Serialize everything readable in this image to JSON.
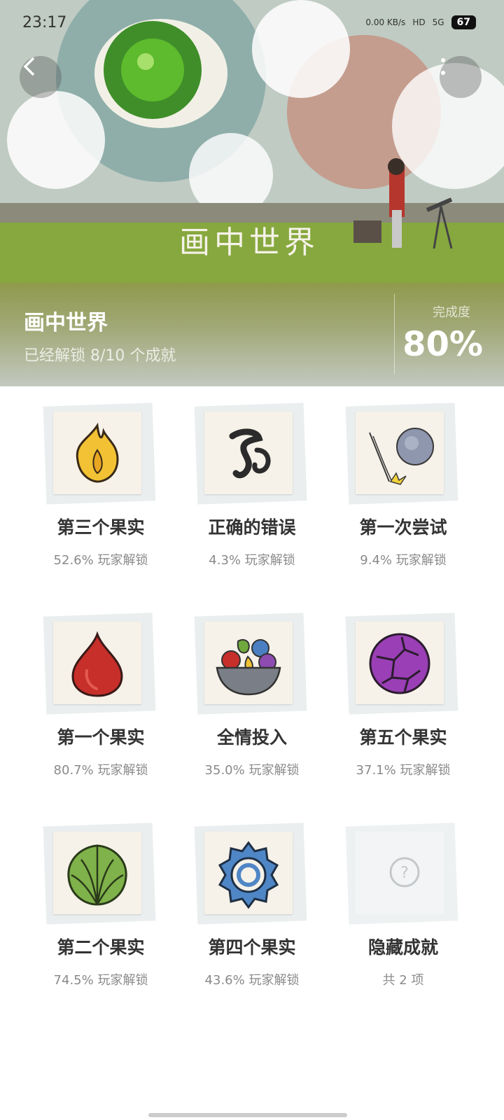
{
  "status_bar": {
    "time": "23:17",
    "network": "0.00 KB/s",
    "hd": "HD",
    "signal": "5G",
    "battery": "67"
  },
  "banner": {
    "logo_text": "画中世界"
  },
  "header": {
    "title": "画中世界",
    "unlock_summary": "已经解锁 8/10 个成就",
    "completion_label": "完成度",
    "completion_value": "80%"
  },
  "achievements": [
    {
      "title": "第三个果实",
      "subtitle": "52.6% 玩家解锁",
      "icon": "flame-fruit-icon"
    },
    {
      "title": "正确的错误",
      "subtitle": "4.3% 玩家解锁",
      "icon": "swirl-symbol-icon"
    },
    {
      "title": "第一次尝试",
      "subtitle": "9.4% 玩家解锁",
      "icon": "puff-ball-icon"
    },
    {
      "title": "第一个果实",
      "subtitle": "80.7% 玩家解锁",
      "icon": "red-drop-fruit-icon"
    },
    {
      "title": "全情投入",
      "subtitle": "35.0% 玩家解锁",
      "icon": "fruit-bowl-icon"
    },
    {
      "title": "第五个果实",
      "subtitle": "37.1% 玩家解锁",
      "icon": "purple-cracked-ball-icon"
    },
    {
      "title": "第二个果实",
      "subtitle": "74.5% 玩家解锁",
      "icon": "green-leaf-fruit-icon"
    },
    {
      "title": "第四个果实",
      "subtitle": "43.6% 玩家解锁",
      "icon": "blue-gear-fruit-icon"
    },
    {
      "title": "隐藏成就",
      "subtitle": "共 2 项",
      "icon": "hidden-question-icon"
    }
  ],
  "colors": {
    "accent": "#8f9a4c",
    "text_primary": "#333333",
    "text_secondary": "#8a8a8a"
  }
}
